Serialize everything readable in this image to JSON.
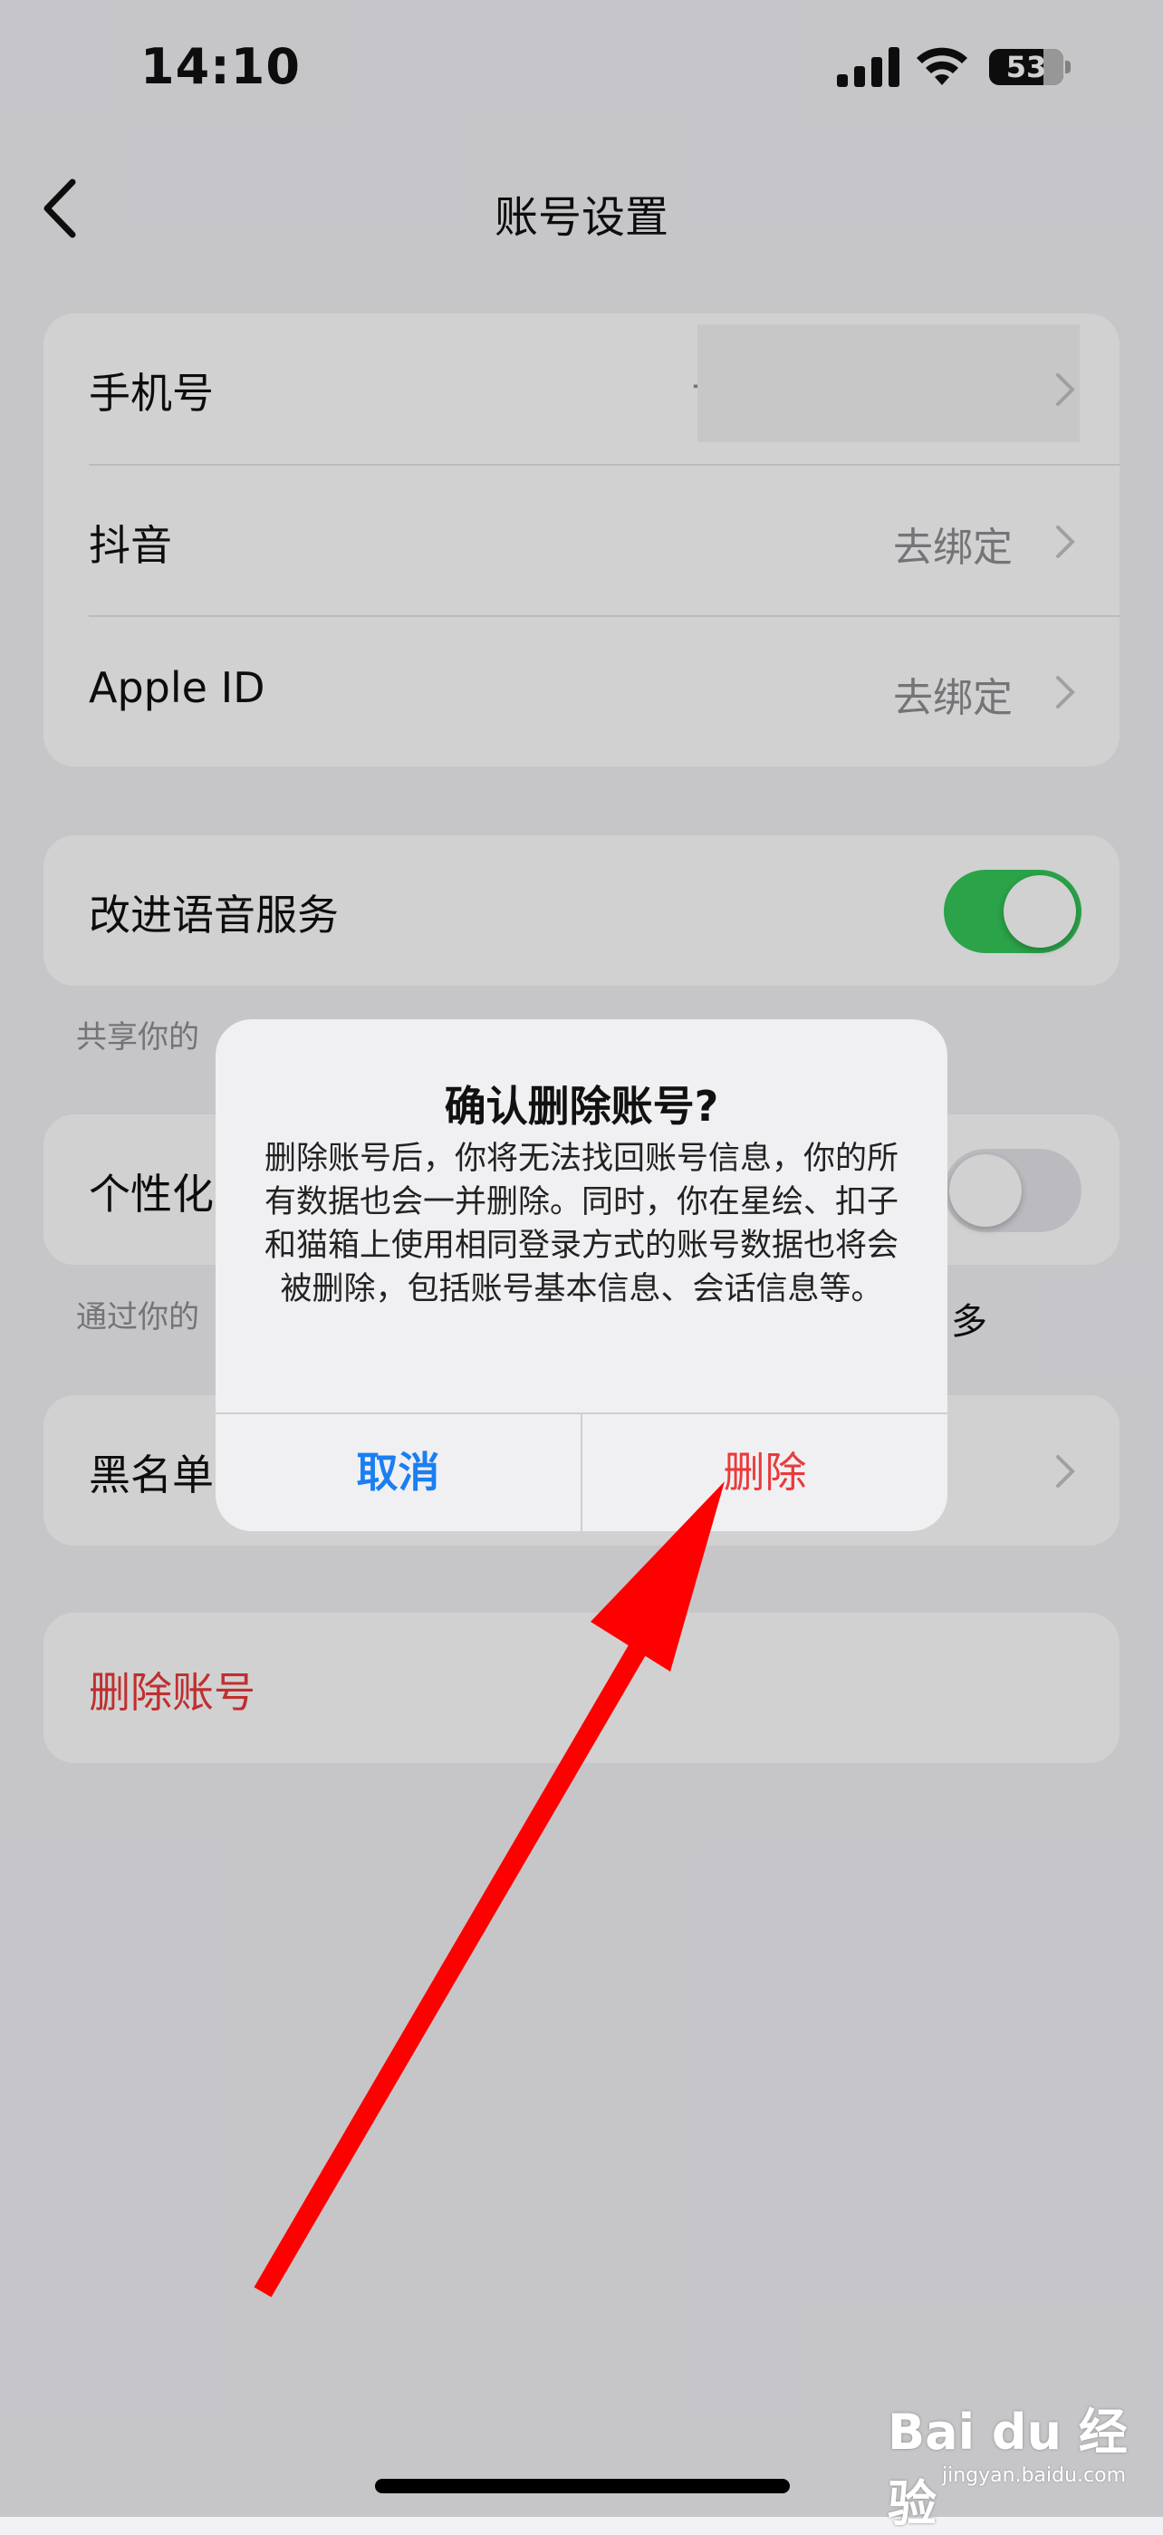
{
  "status_bar": {
    "time": "14:10",
    "battery": "53"
  },
  "nav": {
    "title": "账号设置"
  },
  "accounts": [
    {
      "label": "手机号",
      "value": "+"
    },
    {
      "label": "抖音",
      "value": "去绑定"
    },
    {
      "label": "Apple ID",
      "value": "去绑定"
    }
  ],
  "voice": {
    "label": "改进语音服务",
    "on": true,
    "footer": "共享你的"
  },
  "personal": {
    "label": "个性化",
    "on": false,
    "footer_left": "通过你的",
    "footer_right": "多"
  },
  "blacklist": {
    "label": "黑名单"
  },
  "delete_account": {
    "label": "删除账号"
  },
  "alert": {
    "title": "确认删除账号?",
    "message": "删除账号后，你将无法找回账号信息，你的所有数据也会一并删除。同时，你在星绘、扣子和猫箱上使用相同登录方式的账号数据也将会被删除，包括账号基本信息、会话信息等。",
    "cancel": "取消",
    "confirm": "删除"
  },
  "watermark": {
    "brand": "Bai du 经验",
    "site": "jingyan.baidu.com"
  },
  "colors": {
    "accent_blue": "#1b7ef1",
    "danger_red": "#ea3a3a",
    "toggle_green": "#34c759",
    "arrow_red": "#ff0000"
  }
}
